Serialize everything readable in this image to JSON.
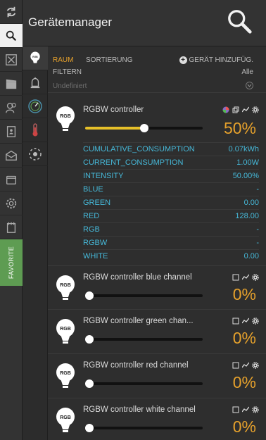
{
  "header": {
    "title": "Gerätemanager",
    "search_icon": "search-icon"
  },
  "rail": {
    "items": [
      {
        "name": "refresh-icon"
      },
      {
        "name": "search-icon",
        "active": true
      },
      {
        "name": "tools-icon"
      },
      {
        "name": "scenes-icon"
      },
      {
        "name": "users-icon"
      },
      {
        "name": "phonebook-icon"
      },
      {
        "name": "messages-icon"
      },
      {
        "name": "wallet-icon"
      },
      {
        "name": "settings-icon"
      },
      {
        "name": "notes-icon"
      }
    ],
    "favorite_label": "FAVORITE"
  },
  "rail2": {
    "items": [
      {
        "name": "bulb-icon",
        "active": true
      },
      {
        "name": "alarm-icon"
      },
      {
        "name": "gauge-icon"
      },
      {
        "name": "thermometer-icon"
      },
      {
        "name": "sensor-icon"
      }
    ]
  },
  "filters": {
    "raum": "RAUM",
    "sortierung": "SORTIERUNG",
    "add_device": "GERÄT HINZUFÜG.",
    "filtern": "FILTERN",
    "alle": "Alle",
    "undefiniert": "Undefiniert"
  },
  "devices": [
    {
      "name": "RGBW controller",
      "bulb_label": "RGB",
      "percent": "50%",
      "level": 0.5,
      "properties": [
        {
          "key": "CUMULATIVE_CONSUMPTION",
          "value": "0.07kWh"
        },
        {
          "key": "CURRENT_CONSUMPTION",
          "value": "1.00W"
        },
        {
          "key": "INTENSITY",
          "value": "50.00%"
        },
        {
          "key": "BLUE",
          "value": "-"
        },
        {
          "key": "GREEN",
          "value": "0.00"
        },
        {
          "key": "RED",
          "value": "128.00"
        },
        {
          "key": "RGB",
          "value": "-"
        },
        {
          "key": "RGBW",
          "value": "-"
        },
        {
          "key": "WHITE",
          "value": "0.00"
        }
      ]
    },
    {
      "name": "RGBW controller blue channel",
      "bulb_label": "RGB",
      "percent": "0%",
      "level": 0
    },
    {
      "name": "RGBW controller green chan...",
      "bulb_label": "RGB",
      "percent": "0%",
      "level": 0
    },
    {
      "name": "RGBW controller red channel",
      "bulb_label": "RGB",
      "percent": "0%",
      "level": 0
    },
    {
      "name": "RGBW controller white channel",
      "bulb_label": "RGB",
      "percent": "0%",
      "level": 0
    }
  ],
  "colors": {
    "accent": "#e6a12c",
    "property": "#46b8d8",
    "favorite": "#5e9c52"
  }
}
